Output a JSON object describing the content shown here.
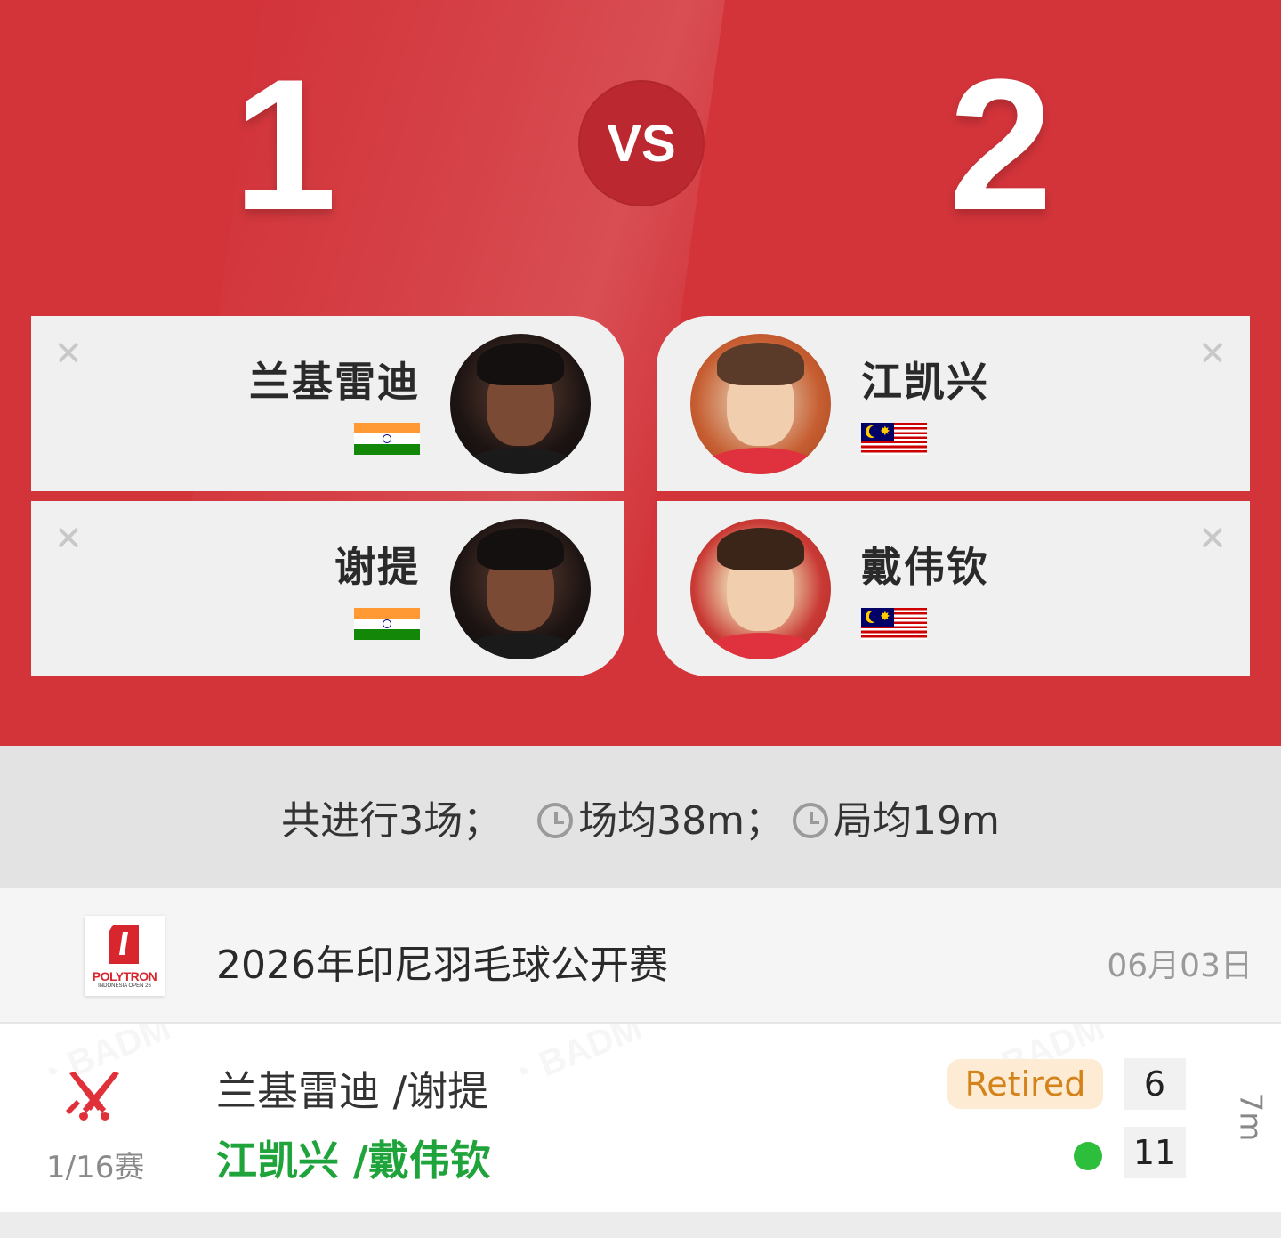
{
  "header": {
    "score_left": "1",
    "score_right": "2",
    "vs_label": "VS",
    "background_color": "#d2343a"
  },
  "team_left": {
    "players": [
      {
        "name": "兰基雷迪",
        "country_flag": "india-flag-icon"
      },
      {
        "name": "谢提",
        "country_flag": "india-flag-icon"
      }
    ]
  },
  "team_right": {
    "players": [
      {
        "name": "江凯兴",
        "country_flag": "malaysia-flag-icon"
      },
      {
        "name": "戴伟钦",
        "country_flag": "malaysia-flag-icon"
      }
    ]
  },
  "stats": {
    "total": "共进行3场；",
    "avg_match": "场均38m；",
    "avg_game": "局均19m"
  },
  "tournament": {
    "logo_brand": "POLYTRON",
    "logo_sub": "INDONESIA OPEN 26",
    "title": "2026年印尼羽毛球公开赛",
    "date": "06月03日"
  },
  "match": {
    "round": "1/16赛",
    "team_loser": "兰基雷迪 /谢提",
    "team_winner": "江凯兴 /戴伟钦",
    "status_badge": "Retired",
    "score_loser": "6",
    "score_winner": "11",
    "duration": "7m",
    "winner_color": "#1fa33b",
    "badge_color": "#d4821a"
  }
}
